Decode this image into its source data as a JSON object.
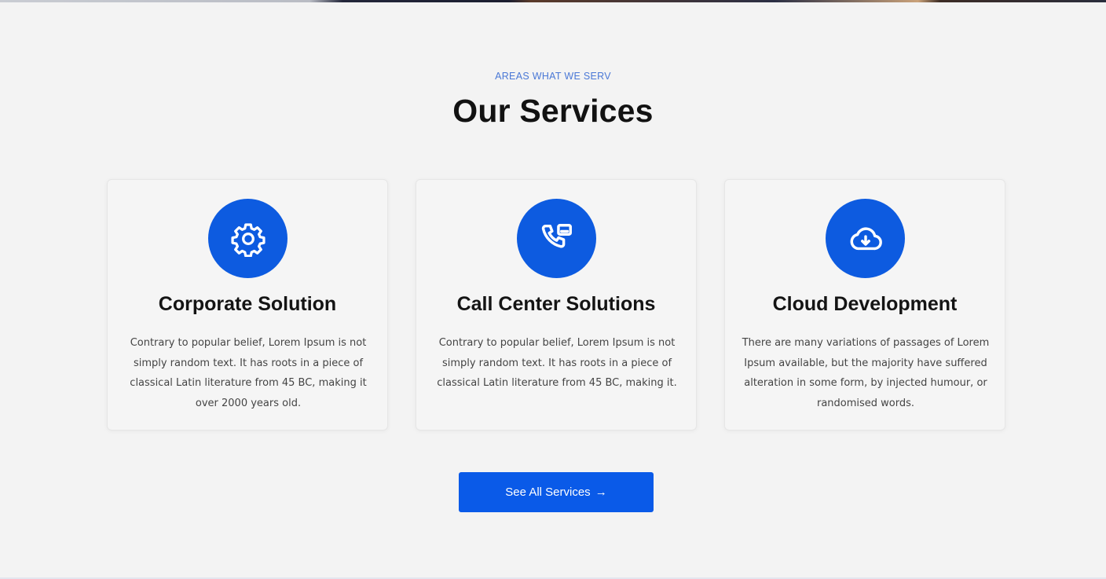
{
  "section": {
    "eyebrow": "AREAS WHAT WE SERV",
    "title": "Our Services"
  },
  "services": [
    {
      "icon": "gear-icon",
      "title": "Corporate Solution",
      "text": "Contrary to popular belief, Lorem Ipsum is not simply random text. It has roots in a piece of classical Latin literature from 45 BC, making it over 2000 years old."
    },
    {
      "icon": "phone-call-icon",
      "title": "Call Center Solutions",
      "text": "Contrary to popular belief, Lorem Ipsum is not simply random text. It has roots in a piece of classical Latin literature from 45 BC, making it."
    },
    {
      "icon": "cloud-download-icon",
      "title": "Cloud Development",
      "text": "There are many variations of passages of Lorem Ipsum available, but the majority have suffered alteration in some form, by injected humour, or randomised words."
    }
  ],
  "cta": {
    "label": "See All Services",
    "arrow": "→"
  },
  "colors": {
    "accent": "#0d5be0",
    "eyebrow": "#4a78d6",
    "background": "#f3f3f3"
  }
}
